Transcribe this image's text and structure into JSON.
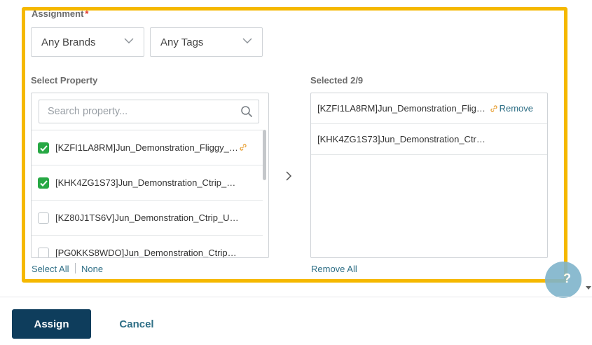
{
  "assignment": {
    "label": "Assignment",
    "required_mark": "*"
  },
  "filters": {
    "brands": {
      "value": "Any Brands",
      "icon": "chevron-down-icon"
    },
    "tags": {
      "value": "Any Tags",
      "icon": "chevron-down-icon"
    }
  },
  "select_property": {
    "label": "Select Property",
    "search_placeholder": "Search property...",
    "items": [
      {
        "text": "[KZFI1LA8RM]Jun_Demonstration_Fliggy_C...",
        "checked": true,
        "linked": true
      },
      {
        "text": "[KHK4ZG1S73]Jun_Demonstration_Ctrip_Conn...",
        "checked": true,
        "linked": false
      },
      {
        "text": "[KZ80J1TS6V]Jun_Demonstration_Ctrip_Uncon...",
        "checked": false,
        "linked": false
      },
      {
        "text": "[PG0KKS8WDO]Jun_Demonstration_Ctrip_Con...",
        "checked": false,
        "linked": false
      }
    ],
    "select_all": "Select All",
    "none": "None"
  },
  "selected": {
    "label": "Selected 2/9",
    "items": [
      {
        "text": "[KZFI1LA8RM]Jun_Demonstration_Fligg...",
        "remove": "Remove"
      },
      {
        "text": "[KHK4ZG1S73]Jun_Demonstration_Ctrip_C..."
      }
    ],
    "remove_all": "Remove All"
  },
  "footer": {
    "assign": "Assign",
    "cancel": "Cancel"
  },
  "help": {
    "glyph": "?"
  },
  "colors": {
    "highlight": "#f5b800",
    "check": "#27a844",
    "link": "#2f6f86",
    "primary": "#0e3d5c",
    "chain": "#e8a23a"
  }
}
